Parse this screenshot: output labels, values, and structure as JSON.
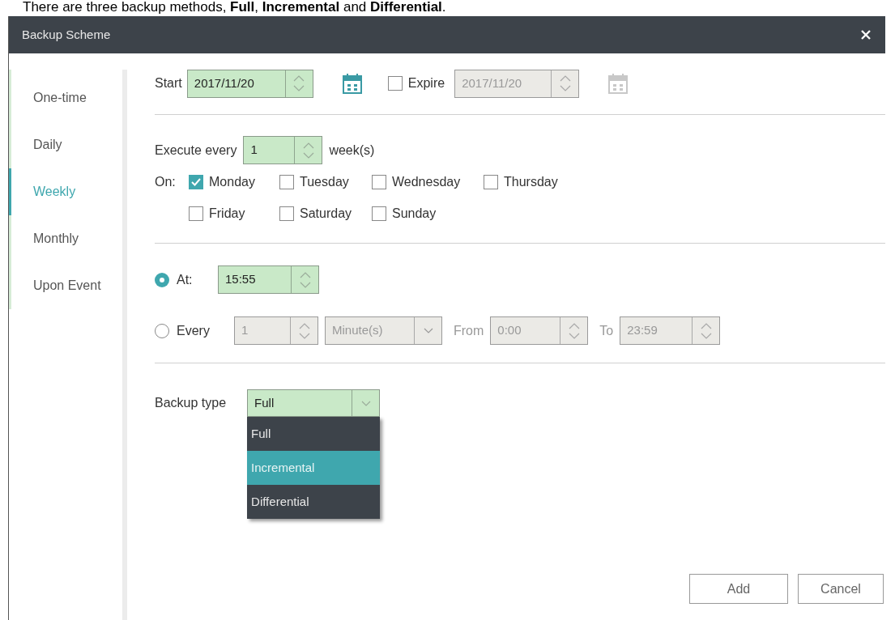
{
  "caption": "There are three backup methods, **Full**, **Incremental** and **Differential**.",
  "window": {
    "title": "Backup Scheme"
  },
  "sidebar": {
    "items": [
      {
        "label": "One-time",
        "selected": false
      },
      {
        "label": "Daily",
        "selected": false
      },
      {
        "label": "Weekly",
        "selected": true
      },
      {
        "label": "Monthly",
        "selected": false
      },
      {
        "label": "Upon Event",
        "selected": false
      }
    ]
  },
  "start": {
    "label": "Start",
    "value": "2017/11/20"
  },
  "expire": {
    "label": "Expire",
    "checked": false,
    "value": "2017/11/20"
  },
  "execute": {
    "label": "Execute every",
    "value": "1",
    "unit": "week(s)"
  },
  "days": {
    "label": "On:",
    "items": [
      {
        "label": "Monday",
        "checked": true
      },
      {
        "label": "Tuesday",
        "checked": false
      },
      {
        "label": "Wednesday",
        "checked": false
      },
      {
        "label": "Thursday",
        "checked": false
      },
      {
        "label": "Friday",
        "checked": false
      },
      {
        "label": "Saturday",
        "checked": false
      },
      {
        "label": "Sunday",
        "checked": false
      }
    ]
  },
  "time_mode": [
    {
      "kind": "at",
      "label": "At:",
      "selected": true,
      "value": "15:55"
    },
    {
      "kind": "every",
      "label": "Every",
      "selected": false,
      "value": "1",
      "unit": "Minute(s)",
      "from_label": "From",
      "from": "0:00",
      "to_label": "To",
      "to": "23:59"
    }
  ],
  "backup_type": {
    "label": "Backup type",
    "value": "Full",
    "expanded": true,
    "options": [
      {
        "label": "Full",
        "highlighted": false
      },
      {
        "label": "Incremental",
        "highlighted": true
      },
      {
        "label": "Differential",
        "highlighted": false
      }
    ]
  },
  "buttons": [
    {
      "label": "Add"
    },
    {
      "label": "Cancel"
    }
  ]
}
